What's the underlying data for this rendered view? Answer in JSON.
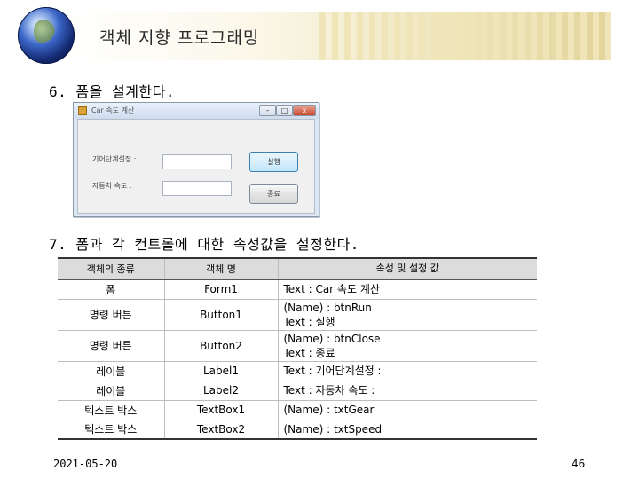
{
  "slide": {
    "title": "객체 지향 프로그래밍",
    "step1": "6. 폼을 설계한다.",
    "step2": "7. 폼과 각 컨트롤에 대한 속성값을 설정한다.",
    "date": "2021-05-20",
    "page_number": "46"
  },
  "form_preview": {
    "title": "Car 속도 계산",
    "minimize_glyph": "–",
    "maximize_glyph": "□",
    "close_glyph": "x",
    "label1": "기어단계설정 :",
    "label2": "자동차 속도 :",
    "button1": "실행",
    "button2": "종료"
  },
  "table": {
    "headers": [
      "객체의 종류",
      "객체 명",
      "속성 및 설정 값"
    ],
    "rows": [
      {
        "type": "폼",
        "name": "Form1",
        "props": [
          "Text : Car 속도 계산"
        ]
      },
      {
        "type": "명령 버튼",
        "name": "Button1",
        "props": [
          "(Name) : btnRun",
          "Text : 실행"
        ]
      },
      {
        "type": "명령 버튼",
        "name": "Button2",
        "props": [
          "(Name) : btnClose",
          "Text : 종료"
        ]
      },
      {
        "type": "레이블",
        "name": "Label1",
        "props": [
          "Text : 기어단계설정 :"
        ]
      },
      {
        "type": "레이블",
        "name": "Label2",
        "props": [
          "Text : 자동차 속도 :"
        ]
      },
      {
        "type": "텍스트 박스",
        "name": "TextBox1",
        "props": [
          "(Name) : txtGear"
        ]
      },
      {
        "type": "텍스트 박스",
        "name": "TextBox2",
        "props": [
          "(Name) : txtSpeed"
        ]
      }
    ]
  },
  "colors": {
    "banner_gold": "#e2d49a",
    "table_header": "#dcdcdc",
    "window_frame": "#dde7f4"
  },
  "icons": {
    "banner": "globe-icon",
    "form": "app-icon"
  }
}
